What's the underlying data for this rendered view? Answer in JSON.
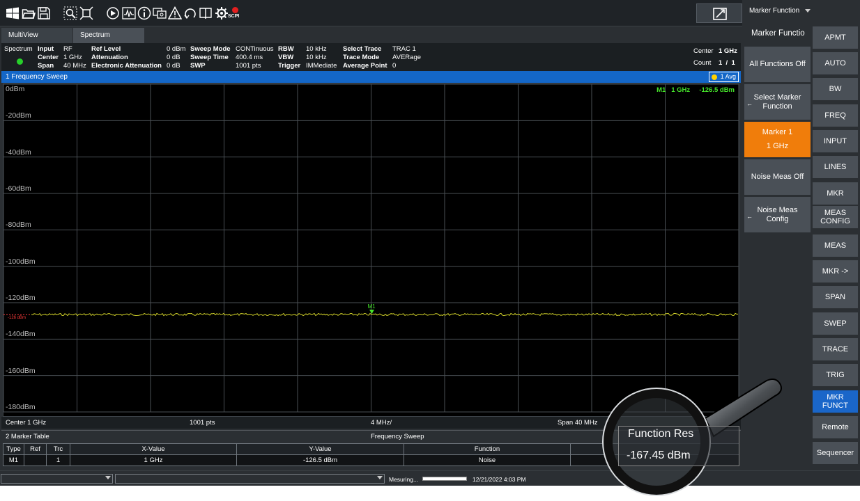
{
  "toolbar": {
    "icons": [
      "windows-icon",
      "open-folder-icon",
      "save-icon",
      "zoom-icon",
      "fit-icon",
      "preset-icon",
      "waveform-icon",
      "info-icon",
      "display-icon",
      "warning-icon",
      "undo-icon",
      "book-icon",
      "settings-icon"
    ],
    "scpi_label": "SCPI"
  },
  "tabs": [
    {
      "label": "MultiView",
      "active": false
    },
    {
      "label": "Spectrum",
      "active": true
    }
  ],
  "info": {
    "channel": "Spectrum",
    "input_label": "Input",
    "input_value": "RF",
    "center_label": "Center",
    "center_value": "1 GHz",
    "span_label": "Span",
    "span_value": "40 MHz",
    "ref_level_label": "Ref Level",
    "ref_level_value": "0 dBm",
    "attenuation_label": "Attenuation",
    "attenuation_value": "0 dB",
    "elec_att_label": "Electronic Attenuation",
    "elec_att_value": "0 dB",
    "sweep_mode_label": "Sweep Mode",
    "sweep_mode_value": "CONTinuous",
    "sweep_time_label": "Sweep Time",
    "sweep_time_value": "400.4 ms",
    "swp_label": "SWP",
    "swp_value": "1001 pts",
    "rbw_label": "RBW",
    "rbw_value": "10 kHz",
    "vbw_label": "VBW",
    "vbw_value": "10 kHz",
    "trigger_label": "Trigger",
    "trigger_value": "IMMediate",
    "select_trace_label": "Select Trace",
    "select_trace_value": "TRAC 1",
    "trace_mode_label": "Trace Mode",
    "trace_mode_value": "AVERage",
    "avg_point_label": "Average Point",
    "avg_point_value": "0",
    "right_center_label": "Center",
    "right_center_value": "1 GHz",
    "count_label": "Count",
    "count_value": "1  /  1"
  },
  "window1": {
    "title": "1  Frequency Sweep",
    "avg_badge": "1 Avg",
    "marker_readout": "M1   1 GHz     -126.5 dBm",
    "ref_tag": "-126 dBm",
    "marker_label": "M1",
    "y_labels": [
      "0dBm",
      "-20dBm",
      "-40dBm",
      "-60dBm",
      "-80dBm",
      "-100dBm",
      "-120dBm",
      "-140dBm",
      "-160dBm",
      "-180dBm"
    ],
    "trace_level_dbm": -126.5,
    "y_range_dbm": [
      -180,
      0
    ],
    "trace_color": "#d6d62a",
    "marker_color": "#45e52a"
  },
  "footer": {
    "center": "Center  1 GHz",
    "points": "1001 pts",
    "div": "4 MHz/",
    "span": "Span  40 MHz"
  },
  "window2": {
    "title": "2  Marker Table",
    "subtitle": "Frequency Sweep",
    "headers": [
      "Type",
      "Ref",
      "Trc",
      "X-Value",
      "Y-Value",
      "Function",
      ""
    ],
    "row": [
      "M1",
      "",
      "1",
      "1 GHz",
      "-126.5 dBm",
      "Noise",
      ""
    ]
  },
  "statusbar": {
    "measuring": "Mesuring...",
    "progress": 1.0,
    "datetime": "12/21/2022 4:03 PM"
  },
  "softkeys": {
    "dropdown": "Marker Function",
    "title": "Marker Functio",
    "items": [
      {
        "label": "All Functions Off",
        "style": "normal",
        "arrow": false
      },
      {
        "label": "Select Marker Function",
        "style": "normal",
        "arrow": true
      },
      {
        "label": "Marker 1",
        "sub": "1 GHz",
        "style": "orange",
        "arrow": false
      },
      {
        "label": "Noise Meas Off",
        "style": "normal",
        "arrow": false
      },
      {
        "label": "Noise Meas Config",
        "style": "normal",
        "arrow": true
      }
    ]
  },
  "hardkeys": [
    "APMT",
    "AUTO",
    "BW",
    "FREQ",
    "INPUT",
    "LINES",
    "MKR",
    "MEAS CONFIG",
    "MEAS",
    "MKR ->",
    "SPAN",
    "SWEP",
    "TRACE",
    "TRIG",
    "MKR FUNCT",
    "Remote",
    "Sequencer"
  ],
  "hardkey_active": "MKR FUNCT",
  "magnifier": {
    "line1": "Function Res",
    "line2": "-167.45 dBm"
  }
}
